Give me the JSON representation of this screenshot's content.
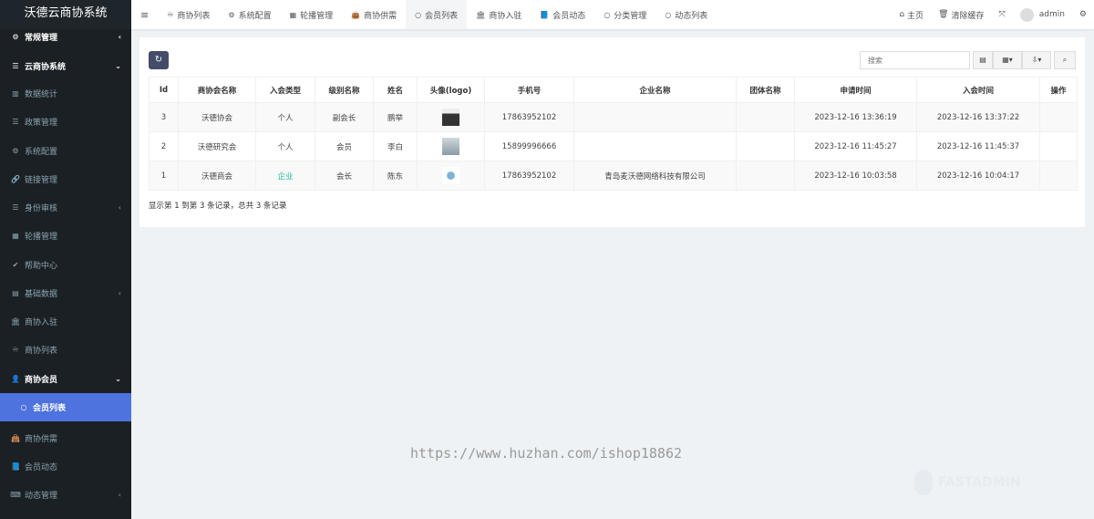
{
  "app": {
    "title": "沃德云商协系统"
  },
  "sidebar": {
    "items": [
      {
        "label": "常规管理",
        "icon": "cogs-icon",
        "chevron": "‹",
        "type": "group"
      },
      {
        "label": "云商协系统",
        "icon": "list-icon",
        "chevron": "⌄",
        "type": "group"
      },
      {
        "label": "数据统计",
        "icon": "bar-chart-icon"
      },
      {
        "label": "政策管理",
        "icon": "list-icon"
      },
      {
        "label": "系统配置",
        "icon": "gear-icon"
      },
      {
        "label": "链接管理",
        "icon": "link-icon"
      },
      {
        "label": "身份审核",
        "icon": "list-icon",
        "chevron": "‹"
      },
      {
        "label": "轮播管理",
        "icon": "th-large-icon"
      },
      {
        "label": "帮助中心",
        "icon": "check-icon"
      },
      {
        "label": "基础数据",
        "icon": "database-icon",
        "chevron": "‹"
      },
      {
        "label": "商协入驻",
        "icon": "bank-icon"
      },
      {
        "label": "商协列表",
        "icon": "handshake-icon"
      },
      {
        "label": "商协会员",
        "icon": "user-icon",
        "chevron": "⌄",
        "type": "group"
      },
      {
        "label": "会员列表",
        "icon": "circle-icon",
        "type": "active"
      },
      {
        "label": "商协供需",
        "icon": "shopping-bag-icon"
      },
      {
        "label": "会员动态",
        "icon": "book-icon"
      },
      {
        "label": "动态管理",
        "icon": "keyboard-icon",
        "chevron": "‹"
      }
    ]
  },
  "topnav": {
    "tabs": [
      {
        "label": "商协列表",
        "icon": "handshake-icon"
      },
      {
        "label": "系统配置",
        "icon": "gear-icon"
      },
      {
        "label": "轮播管理",
        "icon": "th-large-icon"
      },
      {
        "label": "商协供需",
        "icon": "shopping-bag-icon"
      },
      {
        "label": "会员列表",
        "icon": "circle-icon",
        "active": true
      },
      {
        "label": "商协入驻",
        "icon": "bank-icon"
      },
      {
        "label": "会员动态",
        "icon": "book-icon"
      },
      {
        "label": "分类管理",
        "icon": "circle-icon"
      },
      {
        "label": "动态列表",
        "icon": "circle-icon"
      }
    ],
    "home": "主页",
    "clear_cache": "清除缓存",
    "user": "admin"
  },
  "toolbar": {
    "search_placeholder": "搜索"
  },
  "table": {
    "columns": [
      "Id",
      "商协会名称",
      "入会类型",
      "级别名称",
      "姓名",
      "头像(logo)",
      "手机号",
      "企业名称",
      "团体名称",
      "申请时间",
      "入会时间",
      "操作"
    ],
    "rows": [
      {
        "id": "3",
        "name": "沃德协会",
        "type": "个人",
        "level": "副会长",
        "person": "鹏举",
        "phone": "17863952102",
        "company": "",
        "group": "",
        "apply": "2023-12-16 13:36:19",
        "join": "2023-12-16 13:37:22"
      },
      {
        "id": "2",
        "name": "沃德研究会",
        "type": "个人",
        "level": "会员",
        "person": "李白",
        "phone": "15899996666",
        "company": "",
        "group": "",
        "apply": "2023-12-16 11:45:27",
        "join": "2023-12-16 11:45:37"
      },
      {
        "id": "1",
        "name": "沃德商会",
        "type": "企业",
        "level": "会长",
        "person": "陈东",
        "phone": "17863952102",
        "company": "青岛麦沃德网络科技有限公司",
        "group": "",
        "apply": "2023-12-16 10:03:58",
        "join": "2023-12-16 10:04:17"
      }
    ],
    "pagination_info": "显示第 1 到第 3 条记录，总共 3 条记录"
  },
  "watermark": {
    "url": "https://www.huzhan.com/ishop18862",
    "brand": "FASTADMIN"
  },
  "colors": {
    "sidebar_bg": "#1b2024",
    "active": "#4e73df",
    "enterprise": "#18bc9c"
  }
}
